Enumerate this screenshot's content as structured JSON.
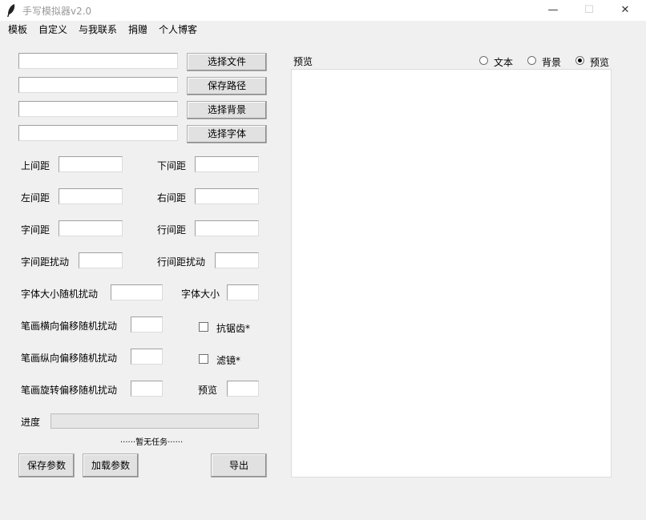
{
  "window": {
    "title": "手写模拟器v2.0",
    "minimize": "—",
    "maximize": "☐",
    "close": "✕"
  },
  "menu": [
    "模板",
    "自定义",
    "与我联系",
    "捐赠",
    "个人博客"
  ],
  "file_rows": [
    {
      "value": "",
      "button": "选择文件"
    },
    {
      "value": "",
      "button": "保存路径"
    },
    {
      "value": "",
      "button": "选择背景"
    },
    {
      "value": "",
      "button": "选择字体"
    }
  ],
  "params": {
    "top_margin": {
      "label": "上间距",
      "value": ""
    },
    "bottom_margin": {
      "label": "下间距",
      "value": ""
    },
    "left_margin": {
      "label": "左间距",
      "value": ""
    },
    "right_margin": {
      "label": "右间距",
      "value": ""
    },
    "char_spacing": {
      "label": "字间距",
      "value": ""
    },
    "line_spacing": {
      "label": "行间距",
      "value": ""
    },
    "char_spacing_jitter": {
      "label": "字间距扰动",
      "value": ""
    },
    "line_spacing_jitter": {
      "label": "行间距扰动",
      "value": ""
    },
    "font_size_jitter": {
      "label": "字体大小随机扰动",
      "value": ""
    },
    "font_size": {
      "label": "字体大小",
      "value": ""
    },
    "stroke_h_jitter": {
      "label": "笔画横向偏移随机扰动",
      "value": ""
    },
    "stroke_v_jitter": {
      "label": "笔画纵向偏移随机扰动",
      "value": ""
    },
    "stroke_rot_jitter": {
      "label": "笔画旋转偏移随机扰动",
      "value": ""
    },
    "preview_count": {
      "label": "预览",
      "value": ""
    }
  },
  "checkboxes": {
    "antialias": {
      "label": "抗锯齿*",
      "checked": false
    },
    "filter": {
      "label": "滤镜*",
      "checked": false
    }
  },
  "progress": {
    "label": "进度",
    "value": 0,
    "status": "······暂无任务······"
  },
  "buttons": {
    "save": "保存参数",
    "load": "加载参数",
    "export": "导出"
  },
  "preview_panel": {
    "label": "预览",
    "radios": [
      {
        "label": "文本",
        "selected": false
      },
      {
        "label": "背景",
        "selected": false
      },
      {
        "label": "预览",
        "selected": true
      }
    ]
  },
  "colors": {
    "progress_fill": "#06b025",
    "window_bg": "#f0f0f0"
  }
}
